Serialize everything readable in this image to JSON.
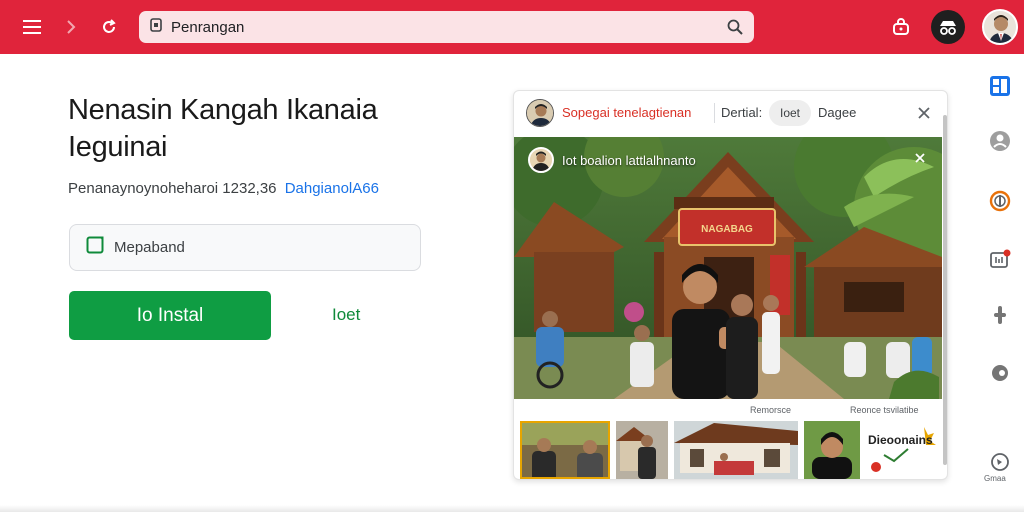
{
  "toolbar": {
    "address_text": "Penrangan",
    "menu_icon": "hamburger-icon",
    "forward_icon": "chevron-right-icon",
    "reload_icon": "reload-icon",
    "site_icon": "page-info-icon",
    "search_icon": "search-icon",
    "extension_icon": "bag-icon",
    "accent_color": "#e0243b"
  },
  "main": {
    "title_line1": "Nenasin Kangah Ikanaia",
    "title_line2": "Ieguinai",
    "meta_text": "Penanaynoynoheharoi 1232,36",
    "meta_link": "DahgianolA66",
    "field_text": "Mepaband",
    "field_icon": "checkbox-icon",
    "install_label": "Io Instal",
    "secondary_label": "Ioet",
    "install_color": "#0f9d43"
  },
  "card": {
    "channel_name": "Sopegai tenelagtienan",
    "detail_label": "Dertial:",
    "chip_label": "Ioet",
    "tab_label": "Dagee",
    "hero_caption": "Iot boalion lattlalhnanto",
    "thumb_label_left": "Remorsce",
    "thumb_label_right": "Reonce tsvilatibe",
    "promo_text": "Dieoonains",
    "name_color": "#d93025"
  },
  "rail": {
    "items": [
      "grid-icon",
      "person-icon",
      "compass-icon",
      "badge-icon",
      "pin-icon",
      "record-icon",
      "globe-icon"
    ],
    "bottom_label": "Gmaa"
  }
}
